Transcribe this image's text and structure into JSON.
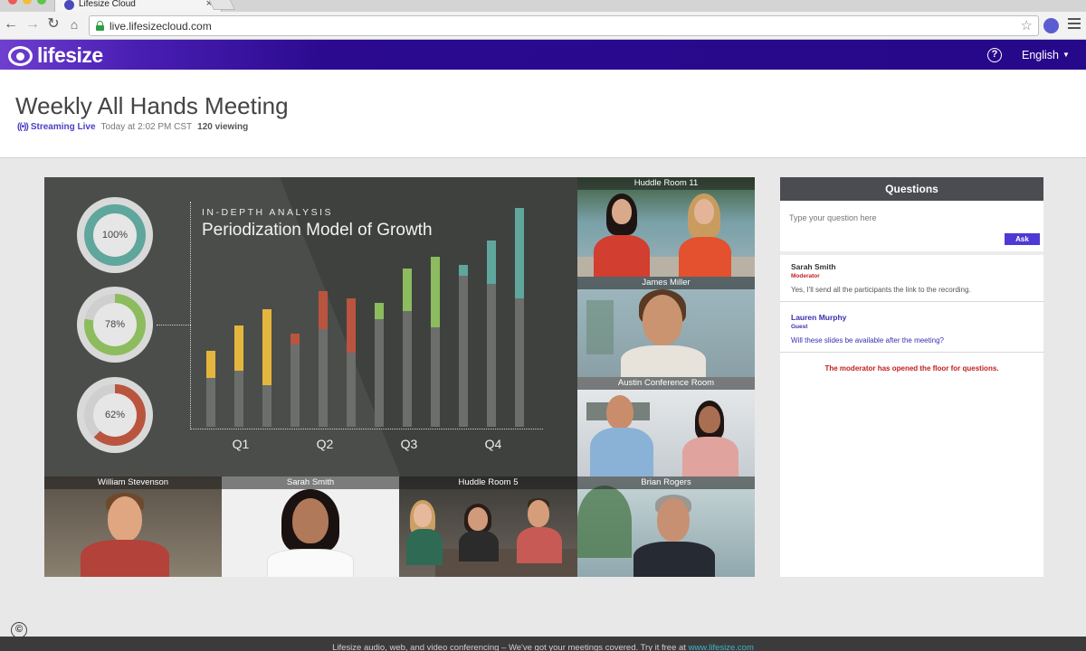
{
  "browser": {
    "tab_title": "Lifesize Cloud",
    "url": "live.lifesizecloud.com"
  },
  "header": {
    "brand": "lifesize",
    "language": "English"
  },
  "event": {
    "title": "Weekly All Hands Meeting",
    "status": "Streaming Live",
    "time": "Today at 2:02 PM CST",
    "viewers": "120 viewing"
  },
  "slide": {
    "kicker": "IN-DEPTH ANALYSIS",
    "title": "Periodization Model of Growth",
    "rings": [
      {
        "label": "100%",
        "percent": 100,
        "color": "#5fa69d"
      },
      {
        "label": "78%",
        "percent": 78,
        "color": "#8cbc5d"
      },
      {
        "label": "62%",
        "percent": 62,
        "color": "#b9553f"
      }
    ],
    "quarters": [
      "Q1",
      "Q2",
      "Q3",
      "Q4"
    ]
  },
  "chart_data": {
    "type": "bar",
    "title": "Periodization Model of Growth",
    "categories": [
      "Q1",
      "Q2",
      "Q3",
      "Q4"
    ],
    "bars": [
      {
        "quarter": "Q1",
        "base": 45,
        "top": 25,
        "color": "#e5b63e"
      },
      {
        "quarter": "Q1",
        "base": 52,
        "top": 41,
        "color": "#e5b63e"
      },
      {
        "quarter": "Q1",
        "base": 38,
        "top": 70,
        "color": "#e5b63e"
      },
      {
        "quarter": "Q2",
        "base": 76,
        "top": 10,
        "color": "#b9553f"
      },
      {
        "quarter": "Q2",
        "base": 90,
        "top": 35,
        "color": "#b9553f"
      },
      {
        "quarter": "Q2",
        "base": 68,
        "top": 50,
        "color": "#b9553f"
      },
      {
        "quarter": "Q3",
        "base": 99,
        "top": 15,
        "color": "#8cbc5d"
      },
      {
        "quarter": "Q3",
        "base": 107,
        "top": 39,
        "color": "#8cbc5d"
      },
      {
        "quarter": "Q3",
        "base": 92,
        "top": 65,
        "color": "#8cbc5d"
      },
      {
        "quarter": "Q4",
        "base": 139,
        "top": 10,
        "color": "#5fa69d"
      },
      {
        "quarter": "Q4",
        "base": 132,
        "top": 40,
        "color": "#5fa69d"
      },
      {
        "quarter": "Q4",
        "base": 118,
        "top": 84,
        "color": "#5fa69d"
      }
    ],
    "ylim": [
      0,
      210
    ]
  },
  "participants": [
    {
      "name": "Huddle Room 11"
    },
    {
      "name": "James Miller"
    },
    {
      "name": "Austin Conference Room"
    },
    {
      "name": "William Stevenson"
    },
    {
      "name": "Sarah Smith"
    },
    {
      "name": "Huddle Room 5"
    },
    {
      "name": "Brian Rogers"
    }
  ],
  "questions": {
    "header": "Questions",
    "placeholder": "Type your question here",
    "ask_label": "Ask",
    "items": [
      {
        "name": "Sarah Smith",
        "role": "Moderator",
        "text": "Yes, I'll send all the participants the link to the recording.",
        "role_color": "#c21d1d",
        "text_color": "#555"
      },
      {
        "name": "Lauren Murphy",
        "role": "Guest",
        "text": "Will these slides be available after the meeting?",
        "role_color": "#3a2fb0",
        "text_color": "#3a2fb0"
      }
    ],
    "notice": "The moderator has opened the floor for questions."
  },
  "footer": {
    "text": "Lifesize audio, web, and video conferencing – We've got your meetings covered. Try it free at",
    "link": "www.lifesize.com"
  }
}
